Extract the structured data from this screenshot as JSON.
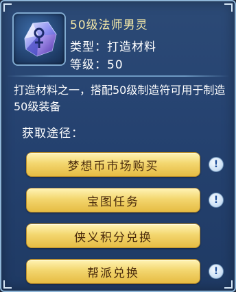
{
  "item": {
    "name": "50级法师男灵",
    "type_line": "类型：打造材料",
    "level_line": "等级：50",
    "description": "打造材料之一，搭配50级制造符可用于制造50级装备",
    "icon": "crystal-gem-icon"
  },
  "acquisition": {
    "title": "获取途径：",
    "routes": [
      {
        "label": "梦想币市场购买",
        "has_alert": true
      },
      {
        "label": "宝图任务",
        "has_alert": true
      },
      {
        "label": "侠义积分兑换",
        "has_alert": false
      },
      {
        "label": "帮派兑换",
        "has_alert": true
      }
    ],
    "alert_glyph": "!"
  },
  "colors": {
    "panel_bg": "#254270",
    "name_text": "#f2e7a8",
    "button_gold": "#f3d66f",
    "button_text": "#4a2b0c"
  }
}
